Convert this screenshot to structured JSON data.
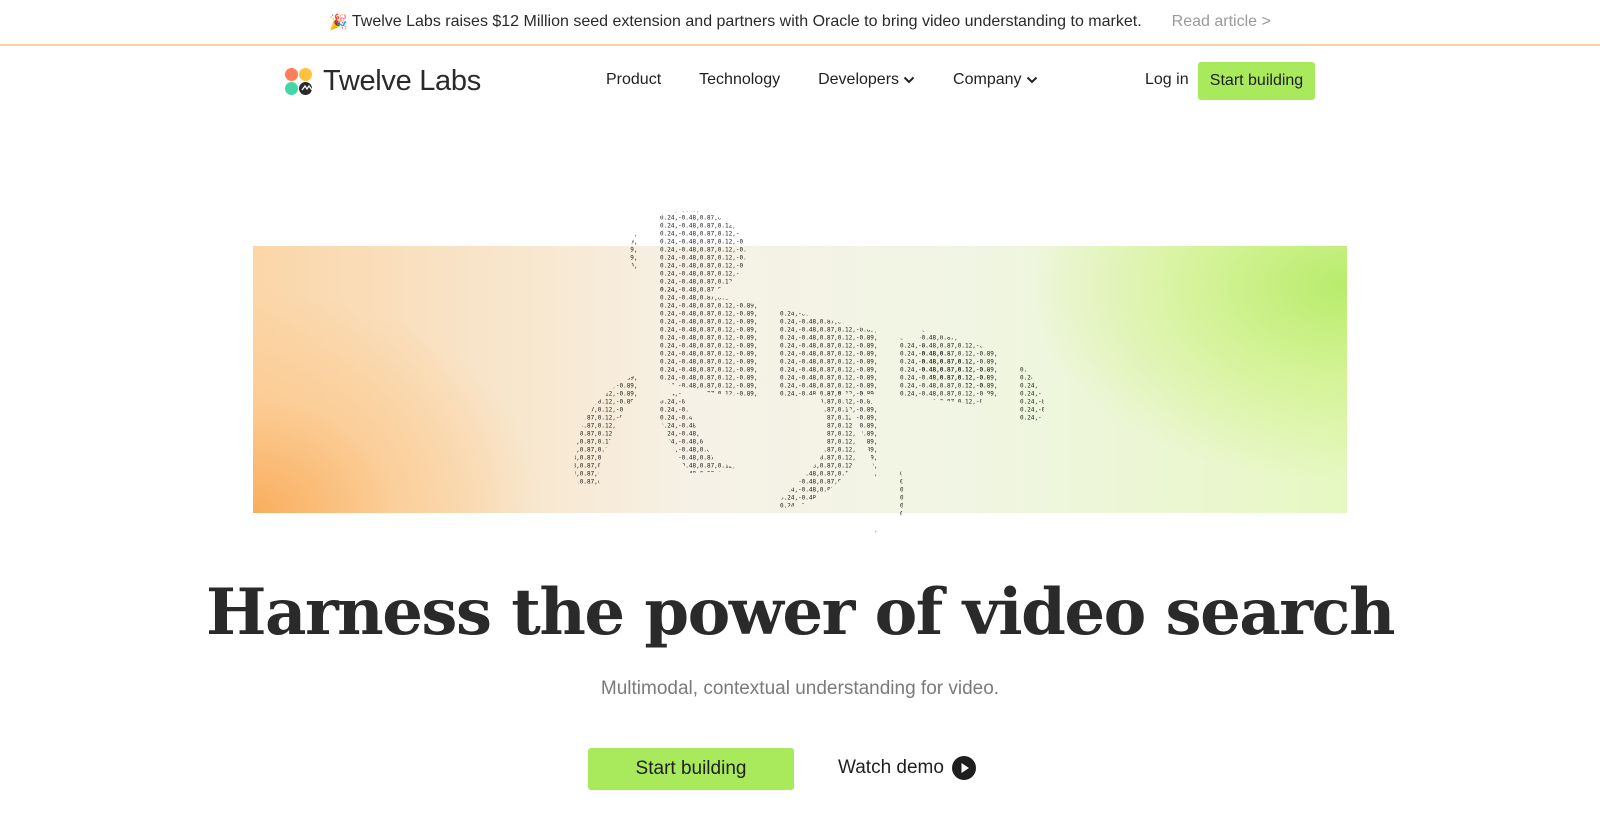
{
  "announcement": {
    "emoji": "🎉",
    "text": "Twelve Labs raises $12 Million seed extension and partners with Oracle to bring video understanding to market.",
    "link": "Read article >"
  },
  "nav": {
    "brand": "Twelve Labs",
    "items": [
      {
        "label": "Product",
        "dropdown": false
      },
      {
        "label": "Technology",
        "dropdown": false
      },
      {
        "label": "Developers",
        "dropdown": true
      },
      {
        "label": "Company",
        "dropdown": true
      }
    ],
    "login": "Log in",
    "cta": "Start building"
  },
  "hero": {
    "headline": "Harness the power of video search",
    "subtext": "Multimodal, contextual understanding for video.",
    "cta": "Start building",
    "secondary": "Watch demo"
  },
  "colors": {
    "accent": "#a8ea5c",
    "text": "#2a2a2a",
    "muted": "#7a7a7a",
    "announce_border": "#f5d3a6"
  },
  "icons": [
    "logo-mark-icon",
    "chevron-down-icon",
    "play-icon"
  ]
}
